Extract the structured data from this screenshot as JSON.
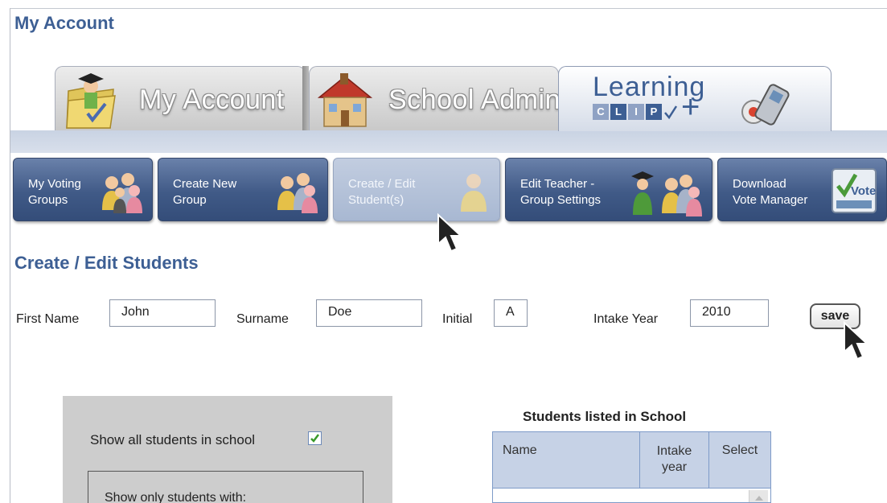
{
  "page": {
    "title": "My Account"
  },
  "tabs": [
    {
      "label": "My Account",
      "icon": "folder-graduate-icon",
      "active": false
    },
    {
      "label": "School Admin",
      "icon": "school-house-icon",
      "active": false
    },
    {
      "label": "Learning Clip + phone",
      "brand_word": "Learning",
      "clip_letters": [
        "C",
        "L",
        "I",
        "P"
      ],
      "plus": "+",
      "icon": "mobile-phone-icon",
      "active": true
    }
  ],
  "subnav": [
    {
      "label": "My Voting\nGroups",
      "icon": "voting-group-icon"
    },
    {
      "label": "Create New\nGroup",
      "icon": "group-people-icon"
    },
    {
      "label": "Create / Edit\nStudent(s)",
      "icon": "student-icon",
      "selected": true
    },
    {
      "label": "Edit Teacher -\nGroup Settings",
      "icon": "teacher-group-icon"
    },
    {
      "label": "Download\nVote Manager",
      "icon": "vote-box-icon",
      "icon_text": "Vote"
    }
  ],
  "form": {
    "section_title": "Create / Edit Students",
    "first_name_label": "First Name",
    "first_name_value": "John",
    "surname_label": "Surname",
    "surname_value": "Doe",
    "initial_label": "Initial",
    "initial_value": "A",
    "intake_label": "Intake Year",
    "intake_value": "2010",
    "save_label": "save"
  },
  "filter": {
    "show_all_label": "Show all students in school",
    "show_all_checked": true,
    "box_label": "Show only students with:"
  },
  "students_table": {
    "title": "Students listed in School",
    "columns": [
      "Name",
      "Intake year",
      "Select"
    ],
    "rows": []
  },
  "colors": {
    "brand_blue": "#3d5f94",
    "nav_button": "#405a87",
    "nav_selected": "#b3c1d8",
    "panel_grey": "#cdcdcd",
    "table_header": "#c6d2e6"
  }
}
